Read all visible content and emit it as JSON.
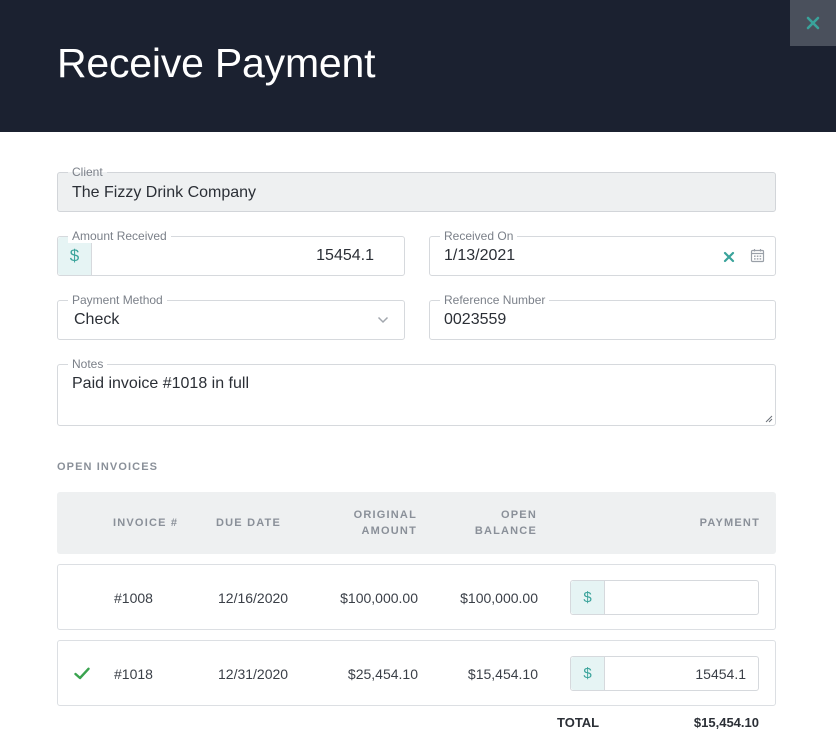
{
  "header": {
    "title": "Receive Payment",
    "close_icon": "close-icon"
  },
  "form": {
    "client": {
      "label": "Client",
      "value": "The Fizzy Drink Company"
    },
    "amount_received": {
      "label": "Amount Received",
      "currency": "$",
      "value": "15454.1"
    },
    "received_on": {
      "label": "Received On",
      "value": "1/13/2021"
    },
    "payment_method": {
      "label": "Payment Method",
      "value": "Check"
    },
    "reference_number": {
      "label": "Reference Number",
      "value": "0023559"
    },
    "notes": {
      "label": "Notes",
      "value": "Paid invoice #1018 in full"
    }
  },
  "open_invoices": {
    "section_label": "OPEN INVOICES",
    "columns": {
      "invoice": "INVOICE #",
      "due_date": "DUE DATE",
      "original_amount_1": "ORIGINAL",
      "original_amount_2": "AMOUNT",
      "open_balance_1": "OPEN",
      "open_balance_2": "BALANCE",
      "payment": "PAYMENT"
    },
    "rows": [
      {
        "checked": false,
        "invoice": "#1008",
        "due_date": "12/16/2020",
        "original_amount": "$100,000.00",
        "open_balance": "$100,000.00",
        "currency": "$",
        "payment": ""
      },
      {
        "checked": true,
        "invoice": "#1018",
        "due_date": "12/31/2020",
        "original_amount": "$25,454.10",
        "open_balance": "$15,454.10",
        "currency": "$",
        "payment": "15454.1"
      }
    ],
    "total_label": "TOTAL",
    "total_value": "$15,454.10"
  },
  "colors": {
    "header_bg": "#1b2130",
    "accent": "#3aa39b",
    "close_bg": "#4a505c"
  }
}
